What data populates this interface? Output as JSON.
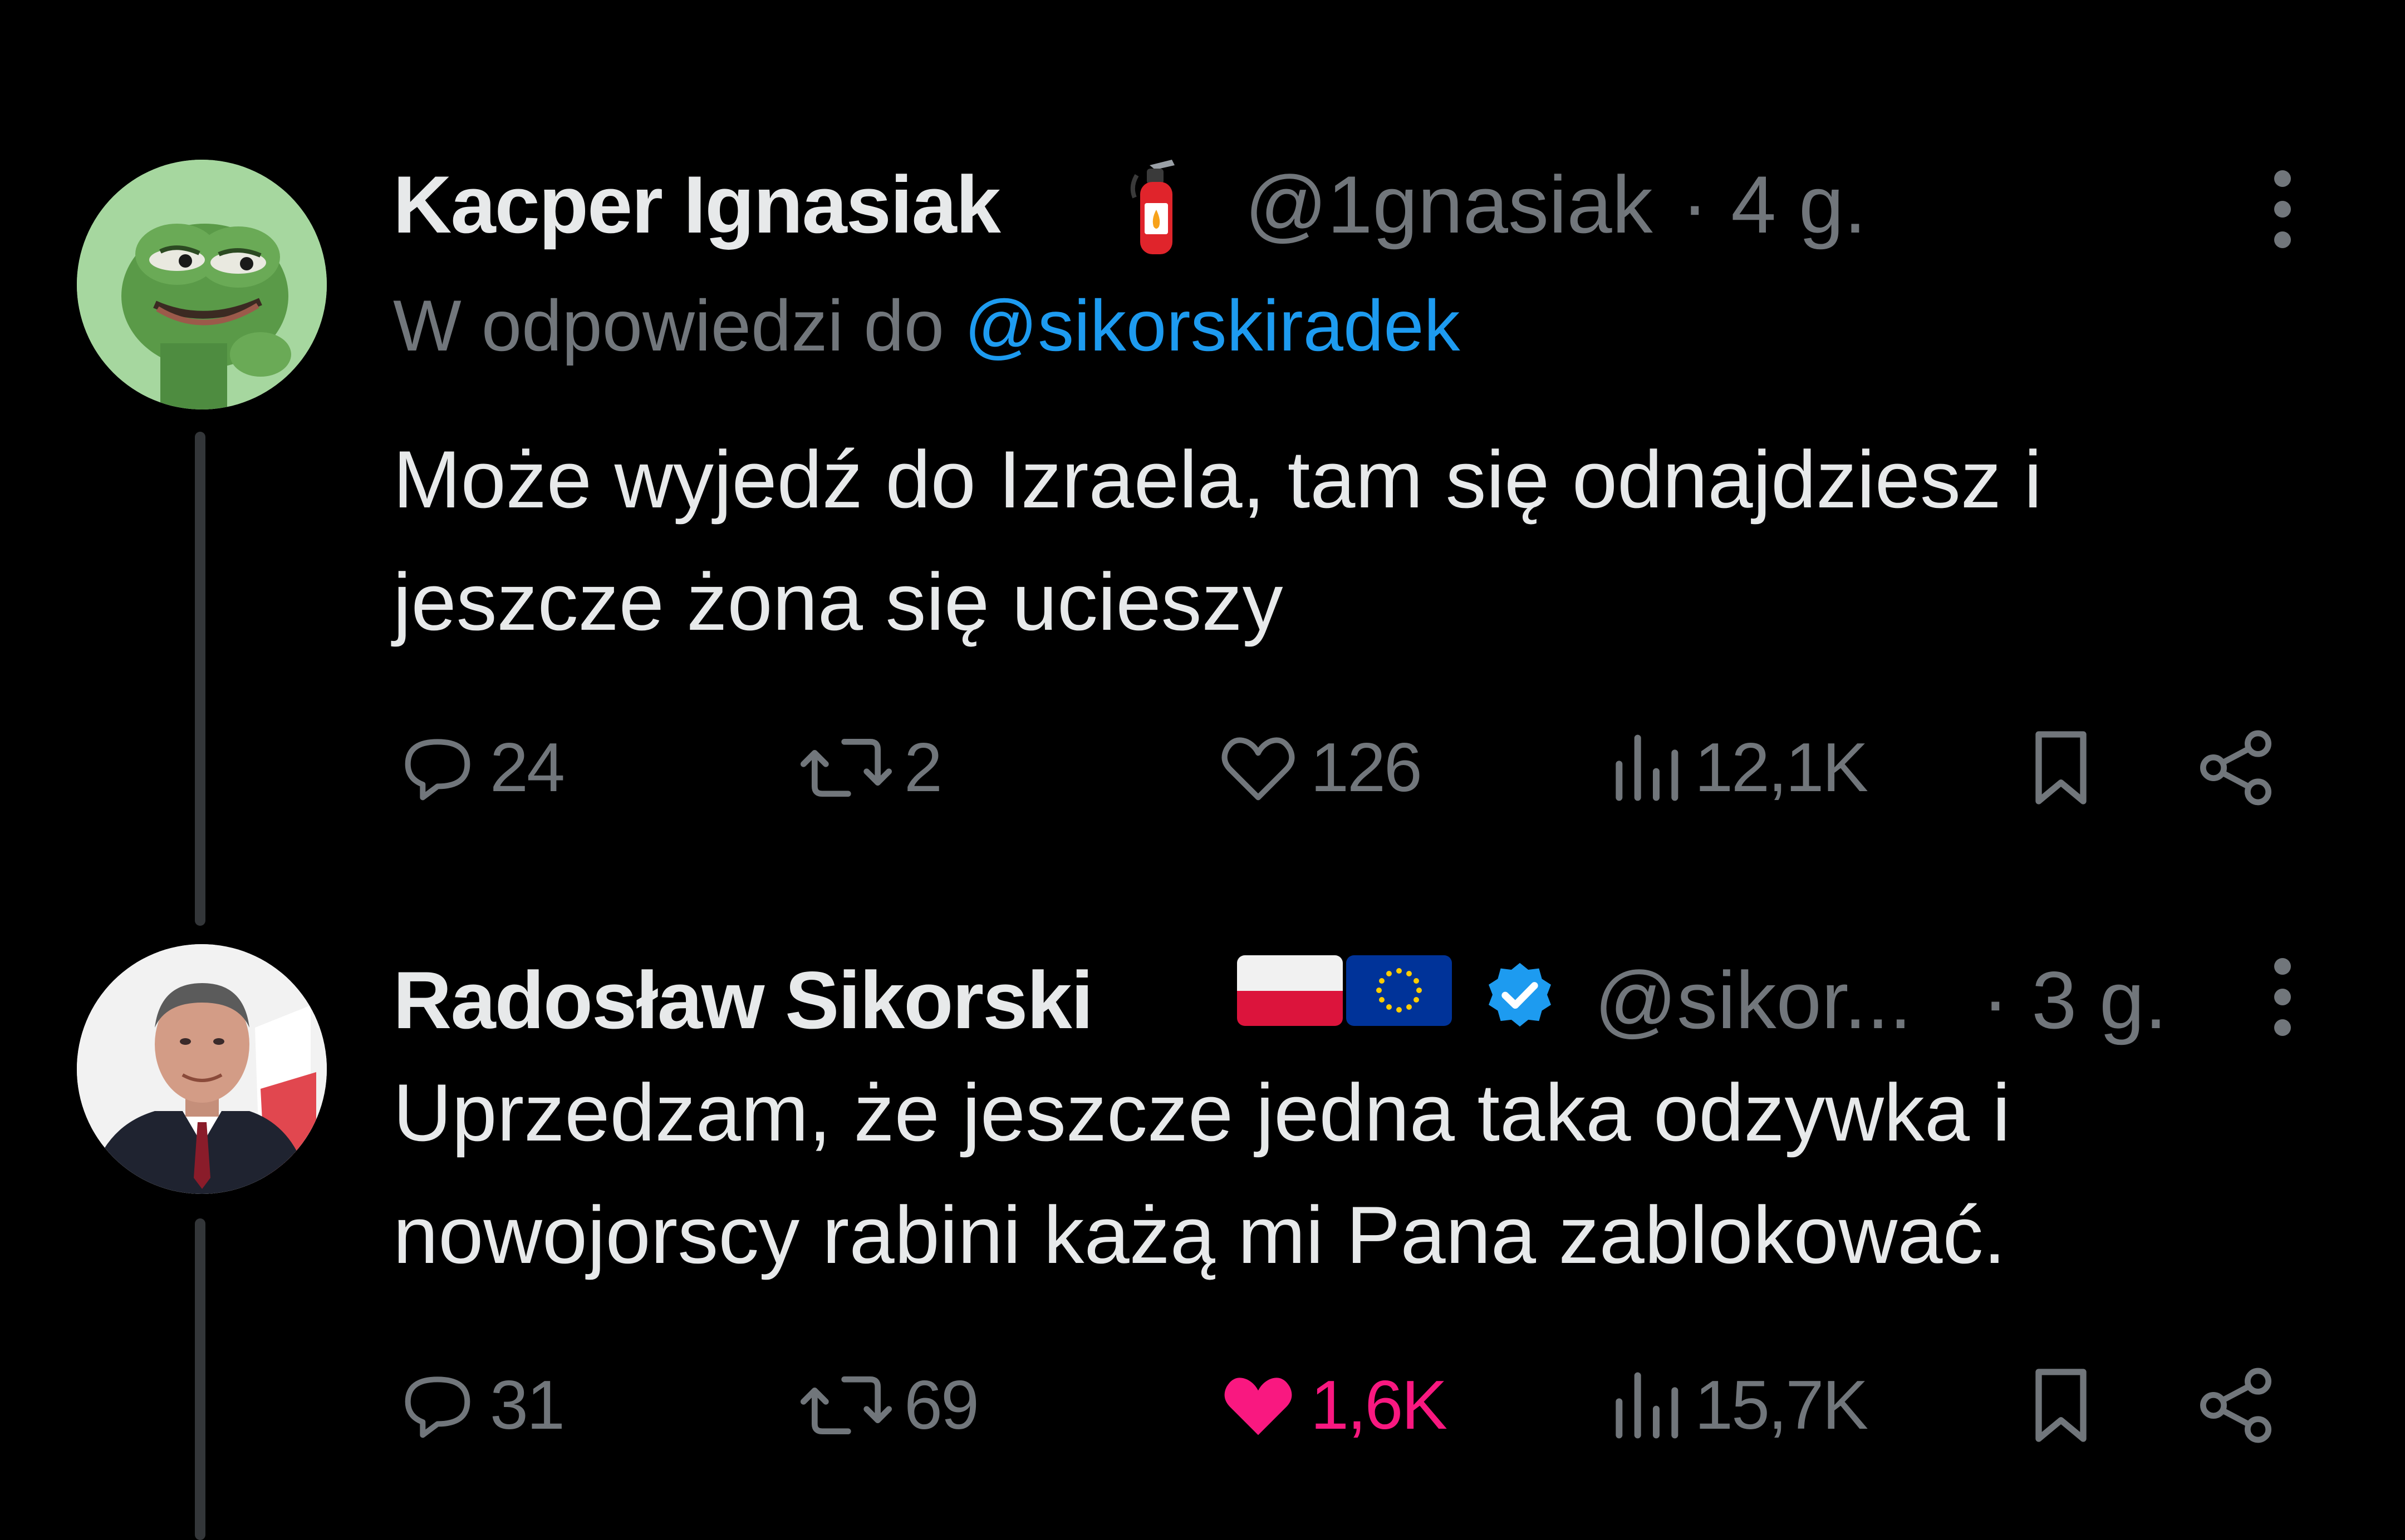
{
  "tweets": [
    {
      "display_name": "Kacper Ignasiak",
      "name_emoji": "fire-extinguisher-icon",
      "handle": "@1gnasiak",
      "time": "· 4 g.",
      "reply_prefix": "W odpowiedzi do",
      "reply_mention": "@sikorskiradek",
      "text_line1": "Może wyjedź do Izraela, tam się odnajdziesz i",
      "text_line2": "jeszcze żona się ucieszy",
      "replies": "24",
      "reposts": "2",
      "likes": "126",
      "views": "12,1K",
      "liked": false
    },
    {
      "display_name": "Radosław Sikorski",
      "name_emoji": [
        "poland-flag-icon",
        "eu-flag-icon"
      ],
      "verified": true,
      "handle": "@sikor...",
      "time": "· 3 g.",
      "text_line1": "Uprzedzam, że jeszcze jedna taka odzywka i",
      "text_line2": "nowojorscy rabini każą mi Pana zablokować.",
      "replies": "31",
      "reposts": "69",
      "likes": "1,6K",
      "views": "15,7K",
      "liked": true
    }
  ],
  "colors": {
    "background": "#000000",
    "text": "#e7e9ea",
    "muted": "#71767b",
    "accent": "#1d9bf0",
    "like": "#f91880"
  }
}
